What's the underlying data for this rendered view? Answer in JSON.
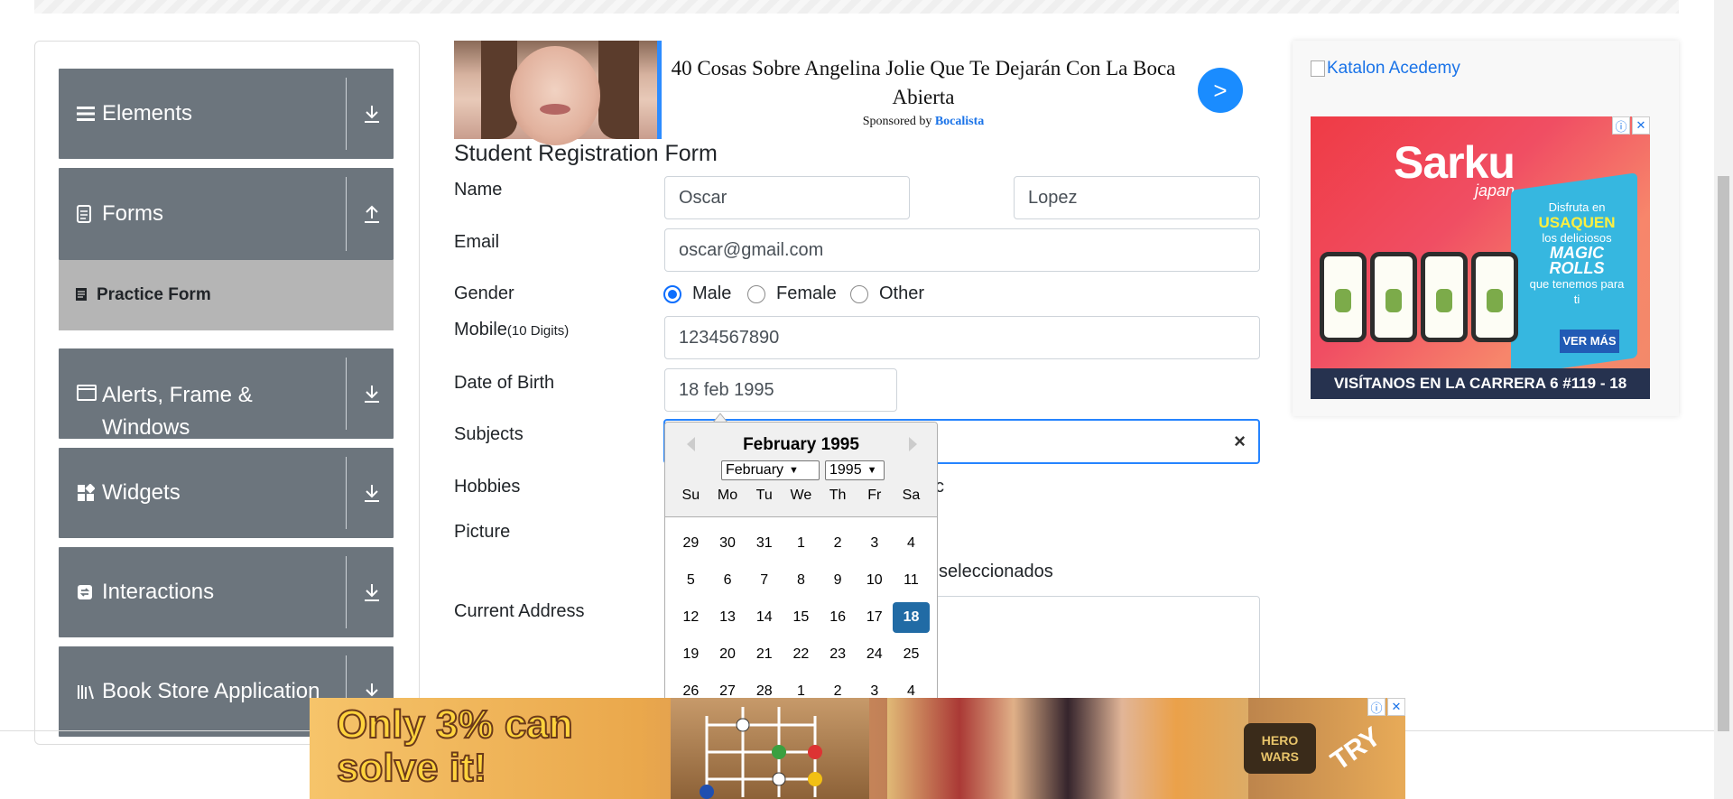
{
  "sidebar": {
    "groups": [
      {
        "label": "Elements",
        "icon": "list-icon",
        "arrow": "download"
      },
      {
        "label": "Forms",
        "icon": "document-icon",
        "arrow": "upload"
      },
      {
        "label": "Alerts, Frame & Windows",
        "icon": "window-icon",
        "arrow": "download"
      },
      {
        "label": "Widgets",
        "icon": "widgets-icon",
        "arrow": "download"
      },
      {
        "label": "Interactions",
        "icon": "interactions-icon",
        "arrow": "download"
      },
      {
        "label": "Book Store Application",
        "icon": "books-icon",
        "arrow": "download"
      }
    ],
    "active_item": "Practice Form"
  },
  "ad_top": {
    "headline": "40 Cosas Sobre Angelina Jolie Que Te Dejarán Con La Boca Abierta",
    "sponsored_prefix": "Sponsored by",
    "sponsor": "Bocalista",
    "go_label": ">"
  },
  "form": {
    "title": "Student Registration Form",
    "name_label": "Name",
    "first_name": "Oscar",
    "last_name": "Lopez",
    "email_label": "Email",
    "email": "oscar@gmail.com",
    "gender_label": "Gender",
    "gender_options": [
      "Male",
      "Female",
      "Other"
    ],
    "gender_selected": "Male",
    "mobile_label": "Mobile",
    "mobile_hint": "(10 Digits)",
    "mobile": "1234567890",
    "dob_label": "Date of Birth",
    "dob": "18 feb 1995",
    "subjects_label": "Subjects",
    "subjects_clear": "×",
    "hobbies_label": "Hobbies",
    "hobbies_partial": "c",
    "picture_label": "Picture",
    "picture_partial": "seleccionados",
    "address_label": "Current Address"
  },
  "datepicker": {
    "title": "February 1995",
    "month_select": "February",
    "year_select": "1995",
    "weekdays": [
      "Su",
      "Mo",
      "Tu",
      "We",
      "Th",
      "Fr",
      "Sa"
    ],
    "weeks": [
      [
        "29",
        "30",
        "31",
        "1",
        "2",
        "3",
        "4"
      ],
      [
        "5",
        "6",
        "7",
        "8",
        "9",
        "10",
        "11"
      ],
      [
        "12",
        "13",
        "14",
        "15",
        "16",
        "17",
        "18"
      ],
      [
        "19",
        "20",
        "21",
        "22",
        "23",
        "24",
        "25"
      ],
      [
        "26",
        "27",
        "28",
        "1",
        "2",
        "3",
        "4"
      ]
    ],
    "selected_day": "18"
  },
  "ad_right": {
    "link_text": "Katalon Acedemy",
    "brand": "Sarku",
    "brand_sub": "japan",
    "promo_line1": "Disfruta en",
    "promo_place": "USAQUEN",
    "promo_line2": "los deliciosos",
    "promo_product": "MAGIC ROLLS",
    "promo_line3": "que tenemos para ti",
    "cta": "VER MÁS",
    "footer": "VISÍTANOS EN LA CARRERA 6 #119 - 18"
  },
  "ad_bottom": {
    "headline": "Only 3% can solve it!",
    "brand": "HERO WARS",
    "cta": "TRY"
  },
  "colors": {
    "sidebar_group": "#6c757d",
    "sidebar_active": "#b5b5b5",
    "focus_border": "#2684ff",
    "selected_day": "#216ba5",
    "radio_on": "#0d6efd"
  }
}
